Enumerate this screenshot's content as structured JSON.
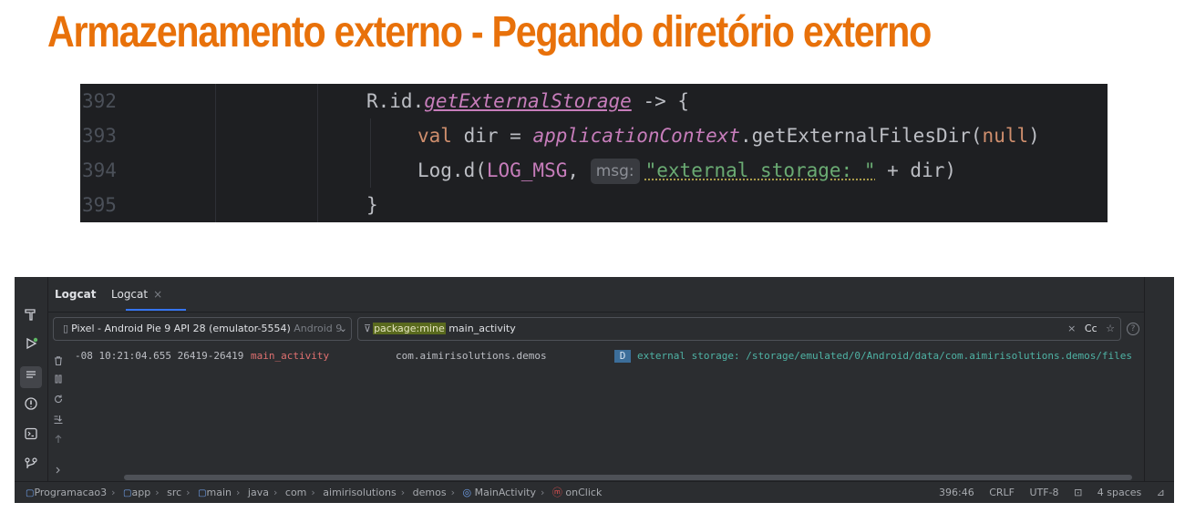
{
  "slide": {
    "title": "Armazenamento externo - Pegando diretório externo"
  },
  "editor": {
    "lines": [
      {
        "number": "392",
        "tokens": [
          "R.id.",
          "getExternalStorage",
          " -> {"
        ]
      },
      {
        "number": "393",
        "tokens": [
          "val",
          " dir = ",
          "applicationContext",
          ".getExternalFilesDir(",
          "null",
          ")"
        ]
      },
      {
        "number": "394",
        "tokens": [
          "Log.d(",
          "LOG_MSG",
          ",",
          "msg:",
          "\"external storage: \"",
          " + dir)"
        ]
      },
      {
        "number": "395",
        "tokens": [
          "}"
        ]
      }
    ]
  },
  "logcat": {
    "panel_title": "Logcat",
    "tab_label": "Logcat",
    "tab_close": "×",
    "device": {
      "name": "Pixel - Android Pie 9 API 28 (emulator-5554)",
      "version": "Android 9"
    },
    "filter": {
      "highlight": "package:mine",
      "rest": " main_activity",
      "case_toggle": "Cc"
    },
    "help": "?",
    "entry": {
      "timestamp": "-08 10:21:04.655 26419-26419",
      "tag": "main_activity",
      "package": "com.aimirisolutions.demos",
      "level": "D",
      "message": "external storage: /storage/emulated/0/Android/data/com.aimirisolutions.demos/files"
    }
  },
  "statusbar": {
    "breadcrumbs": [
      "Programacao3",
      "app",
      "src",
      "main",
      "java",
      "com",
      "aimirisolutions",
      "demos",
      "MainActivity",
      "onClick"
    ],
    "position": "396:46",
    "line_ending": "CRLF",
    "encoding": "UTF-8",
    "indent": "4 spaces"
  },
  "colors": {
    "accent": "#e8710a",
    "editor_bg": "#1e1f22",
    "ide_bg": "#2b2d30"
  },
  "icons": [
    "build-hammer-icon",
    "run-icon",
    "logcat-icon",
    "problems-icon",
    "terminal-icon",
    "git-icon",
    "trash-icon",
    "pause-icon",
    "restart-icon",
    "scroll-to-end-icon",
    "up-arrow-icon",
    "expand-chevron-icon",
    "filter-icon",
    "star-icon",
    "lock-icon",
    "module-icon",
    "class-icon",
    "method-icon"
  ]
}
